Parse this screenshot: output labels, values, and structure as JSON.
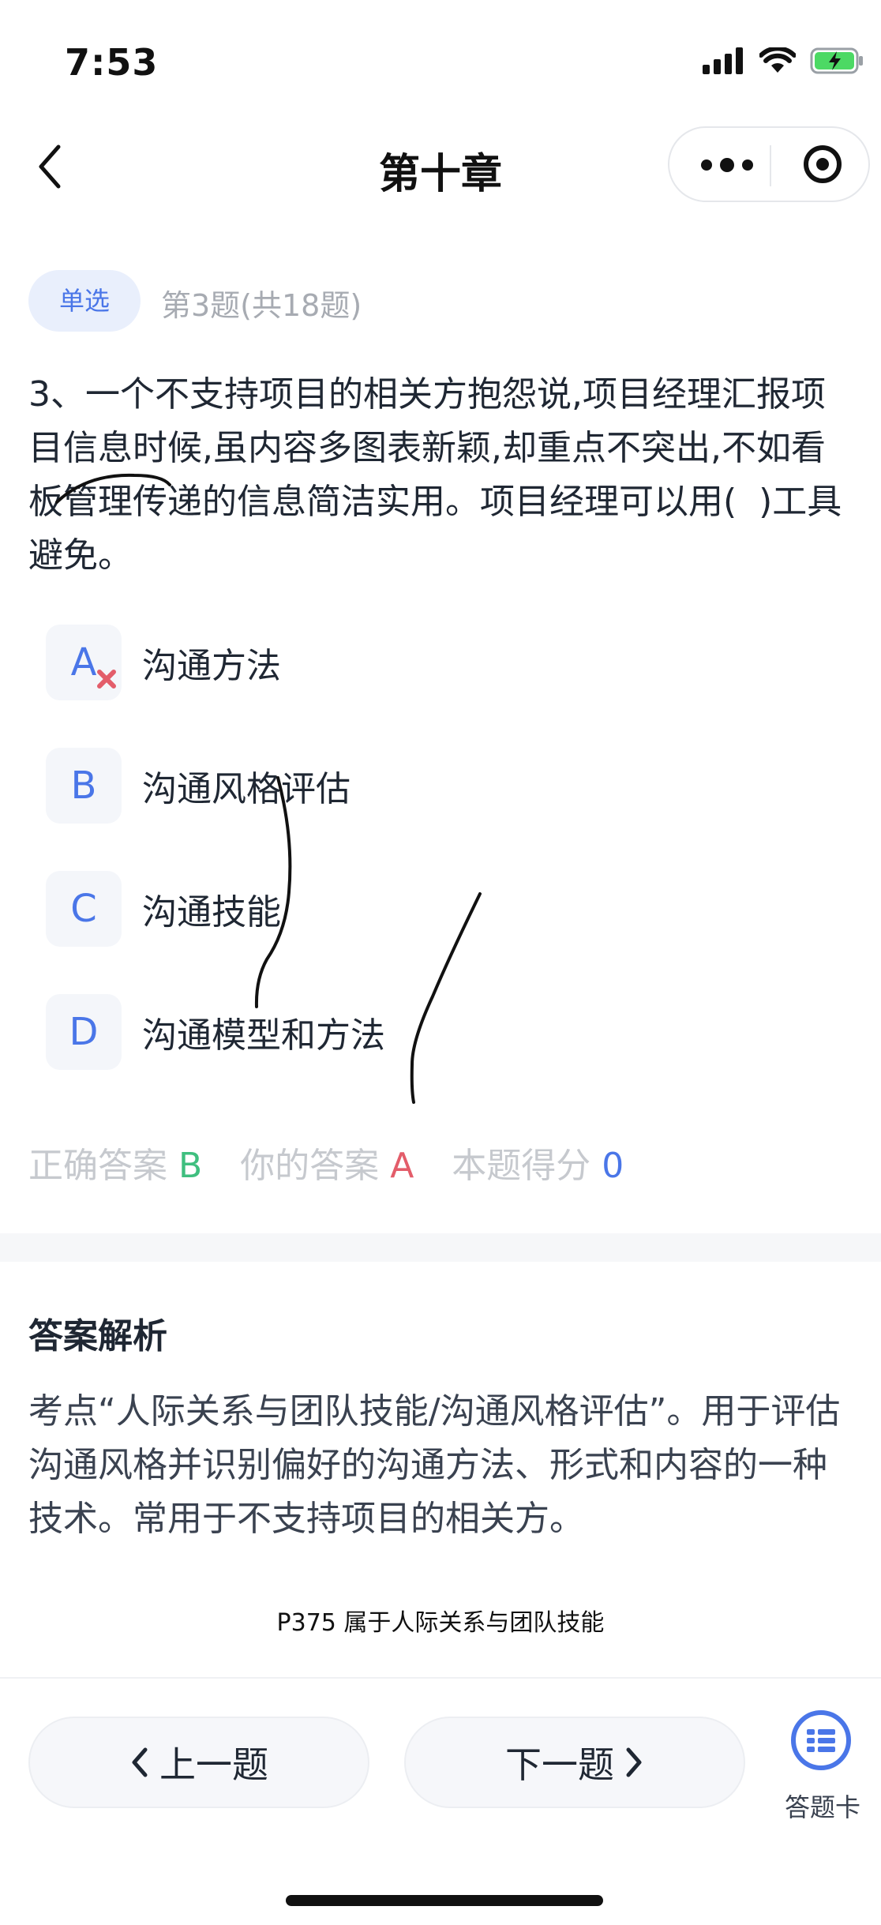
{
  "status_bar": {
    "time": "7:53"
  },
  "nav": {
    "title": "第十章"
  },
  "question_meta": {
    "type_tag": "单选",
    "number_text": "第3题(共18题)"
  },
  "question": {
    "text": "3、一个不支持项目的相关方抱怨说,项目经理汇报项目信息时候,虽内容多图表新颖,却重点不突出,不如看板管理传递的信息简洁实用。项目经理可以用(  )工具避免。"
  },
  "options": [
    {
      "letter": "A",
      "text": "沟通方法"
    },
    {
      "letter": "B",
      "text": "沟通风格评估"
    },
    {
      "letter": "C",
      "text": "沟通技能"
    },
    {
      "letter": "D",
      "text": "沟通模型和方法"
    }
  ],
  "result": {
    "correct_label": "正确答案",
    "correct_value": "B",
    "yours_label": "你的答案",
    "yours_value": "A",
    "score_label": "本题得分",
    "score_value": "0",
    "colors": {
      "correct": "#3fbf7f",
      "wrong": "#e35d6a",
      "score": "#4a76e8"
    }
  },
  "analysis": {
    "title": "答案解析",
    "text": "考点“人际关系与团队技能/沟通风格评估”。用于评估沟通风格并识别偏好的沟通方法、形式和内容的一种技术。常用于不支持项目的相关方。",
    "note": "P375 属于人际关系与团队技能"
  },
  "footer": {
    "prev_label": "上一题",
    "next_label": "下一题",
    "card_label": "答题卡"
  },
  "icons": [
    "signal-icon",
    "wifi-icon",
    "battery-charging-icon",
    "back-chevron-icon",
    "more-dots-icon",
    "target-icon",
    "wrong-x-icon",
    "answer-card-icon"
  ],
  "accent_color": "#4a76e8"
}
